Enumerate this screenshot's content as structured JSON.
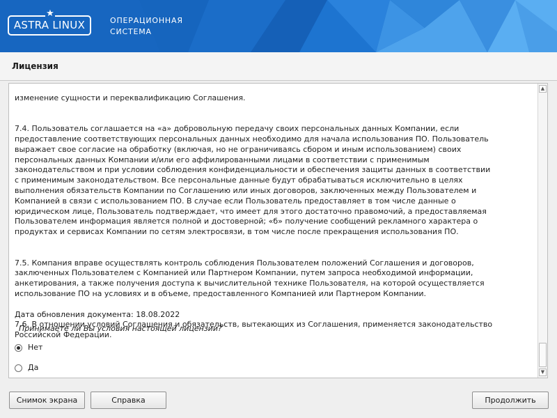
{
  "header": {
    "logo_text": "ASTRA LINUX",
    "logo_mark": "★",
    "os_line1": "ОПЕРАЦИОННАЯ",
    "os_line2": "СИСТЕМА",
    "brand_color": "#1766c0"
  },
  "page": {
    "title": "Лицензия"
  },
  "license": {
    "paragraphs": [
      "изменение сущности и переквалификацию Соглашения.",
      "7.4. Пользователь соглашается на «а» добровольную передачу своих персональных данных Компании, если\nпредоставление соответствующих персональных данных необходимо для начала использования ПО. Пользователь\nвыражает свое согласие на обработку (включая, но не ограничиваясь сбором и иным использованием) своих\nперсональных данных Компании и/или его аффилированными лицами в соответствии с применимым\nзаконодательством и при условии соблюдения конфиденциальности и обеспечения защиты данных в соответствии\nс применимым законодательством. Все персональные данные будут обрабатываться исключительно в целях\nвыполнения обязательств Компании по Соглашению или иных договоров, заключенных между Пользователем и\nКомпанией в связи с использованием ПО. В случае если Пользователь предоставляет в том числе данные о\nюридическом лице, Пользователь подтверждает, что имеет для этого достаточно правомочий, а предоставляемая\nПользователем информация является полной и достоверной; «б» получение сообщений рекламного характера о\nпродуктах и сервисах Компании по сетям электросвязи, в том числе после прекращения использования ПО.",
      "7.5. Компания вправе осуществлять контроль соблюдения Пользователем положений Соглашения и договоров,\nзаключенных Пользователем с Компанией или Партнером Компании, путем запроса необходимой информации,\nанкетирования, а также получения доступа к вычислительной технике Пользователя, на которой осуществляется\nиспользование ПО на условиях и в объеме, предоставленного Компанией или Партнером Компании.",
      "7.6. В отношении условий Соглашения и обязательств, вытекающих из Соглашения, применяется законодательство\nРоссийской Федерации."
    ],
    "updated": "Дата обновления документа: 18.08.2022",
    "question": "Принимаете ли Вы условия настоящей лицензии?",
    "options": [
      {
        "label": "Нет",
        "selected": true
      },
      {
        "label": "Да",
        "selected": false
      }
    ]
  },
  "scroll": {
    "up_icon": "▲",
    "down_icon": "▼",
    "position_fraction": 0.95
  },
  "buttons": {
    "screenshot": "Снимок экрана",
    "help": "Справка",
    "continue": "Продолжить"
  }
}
